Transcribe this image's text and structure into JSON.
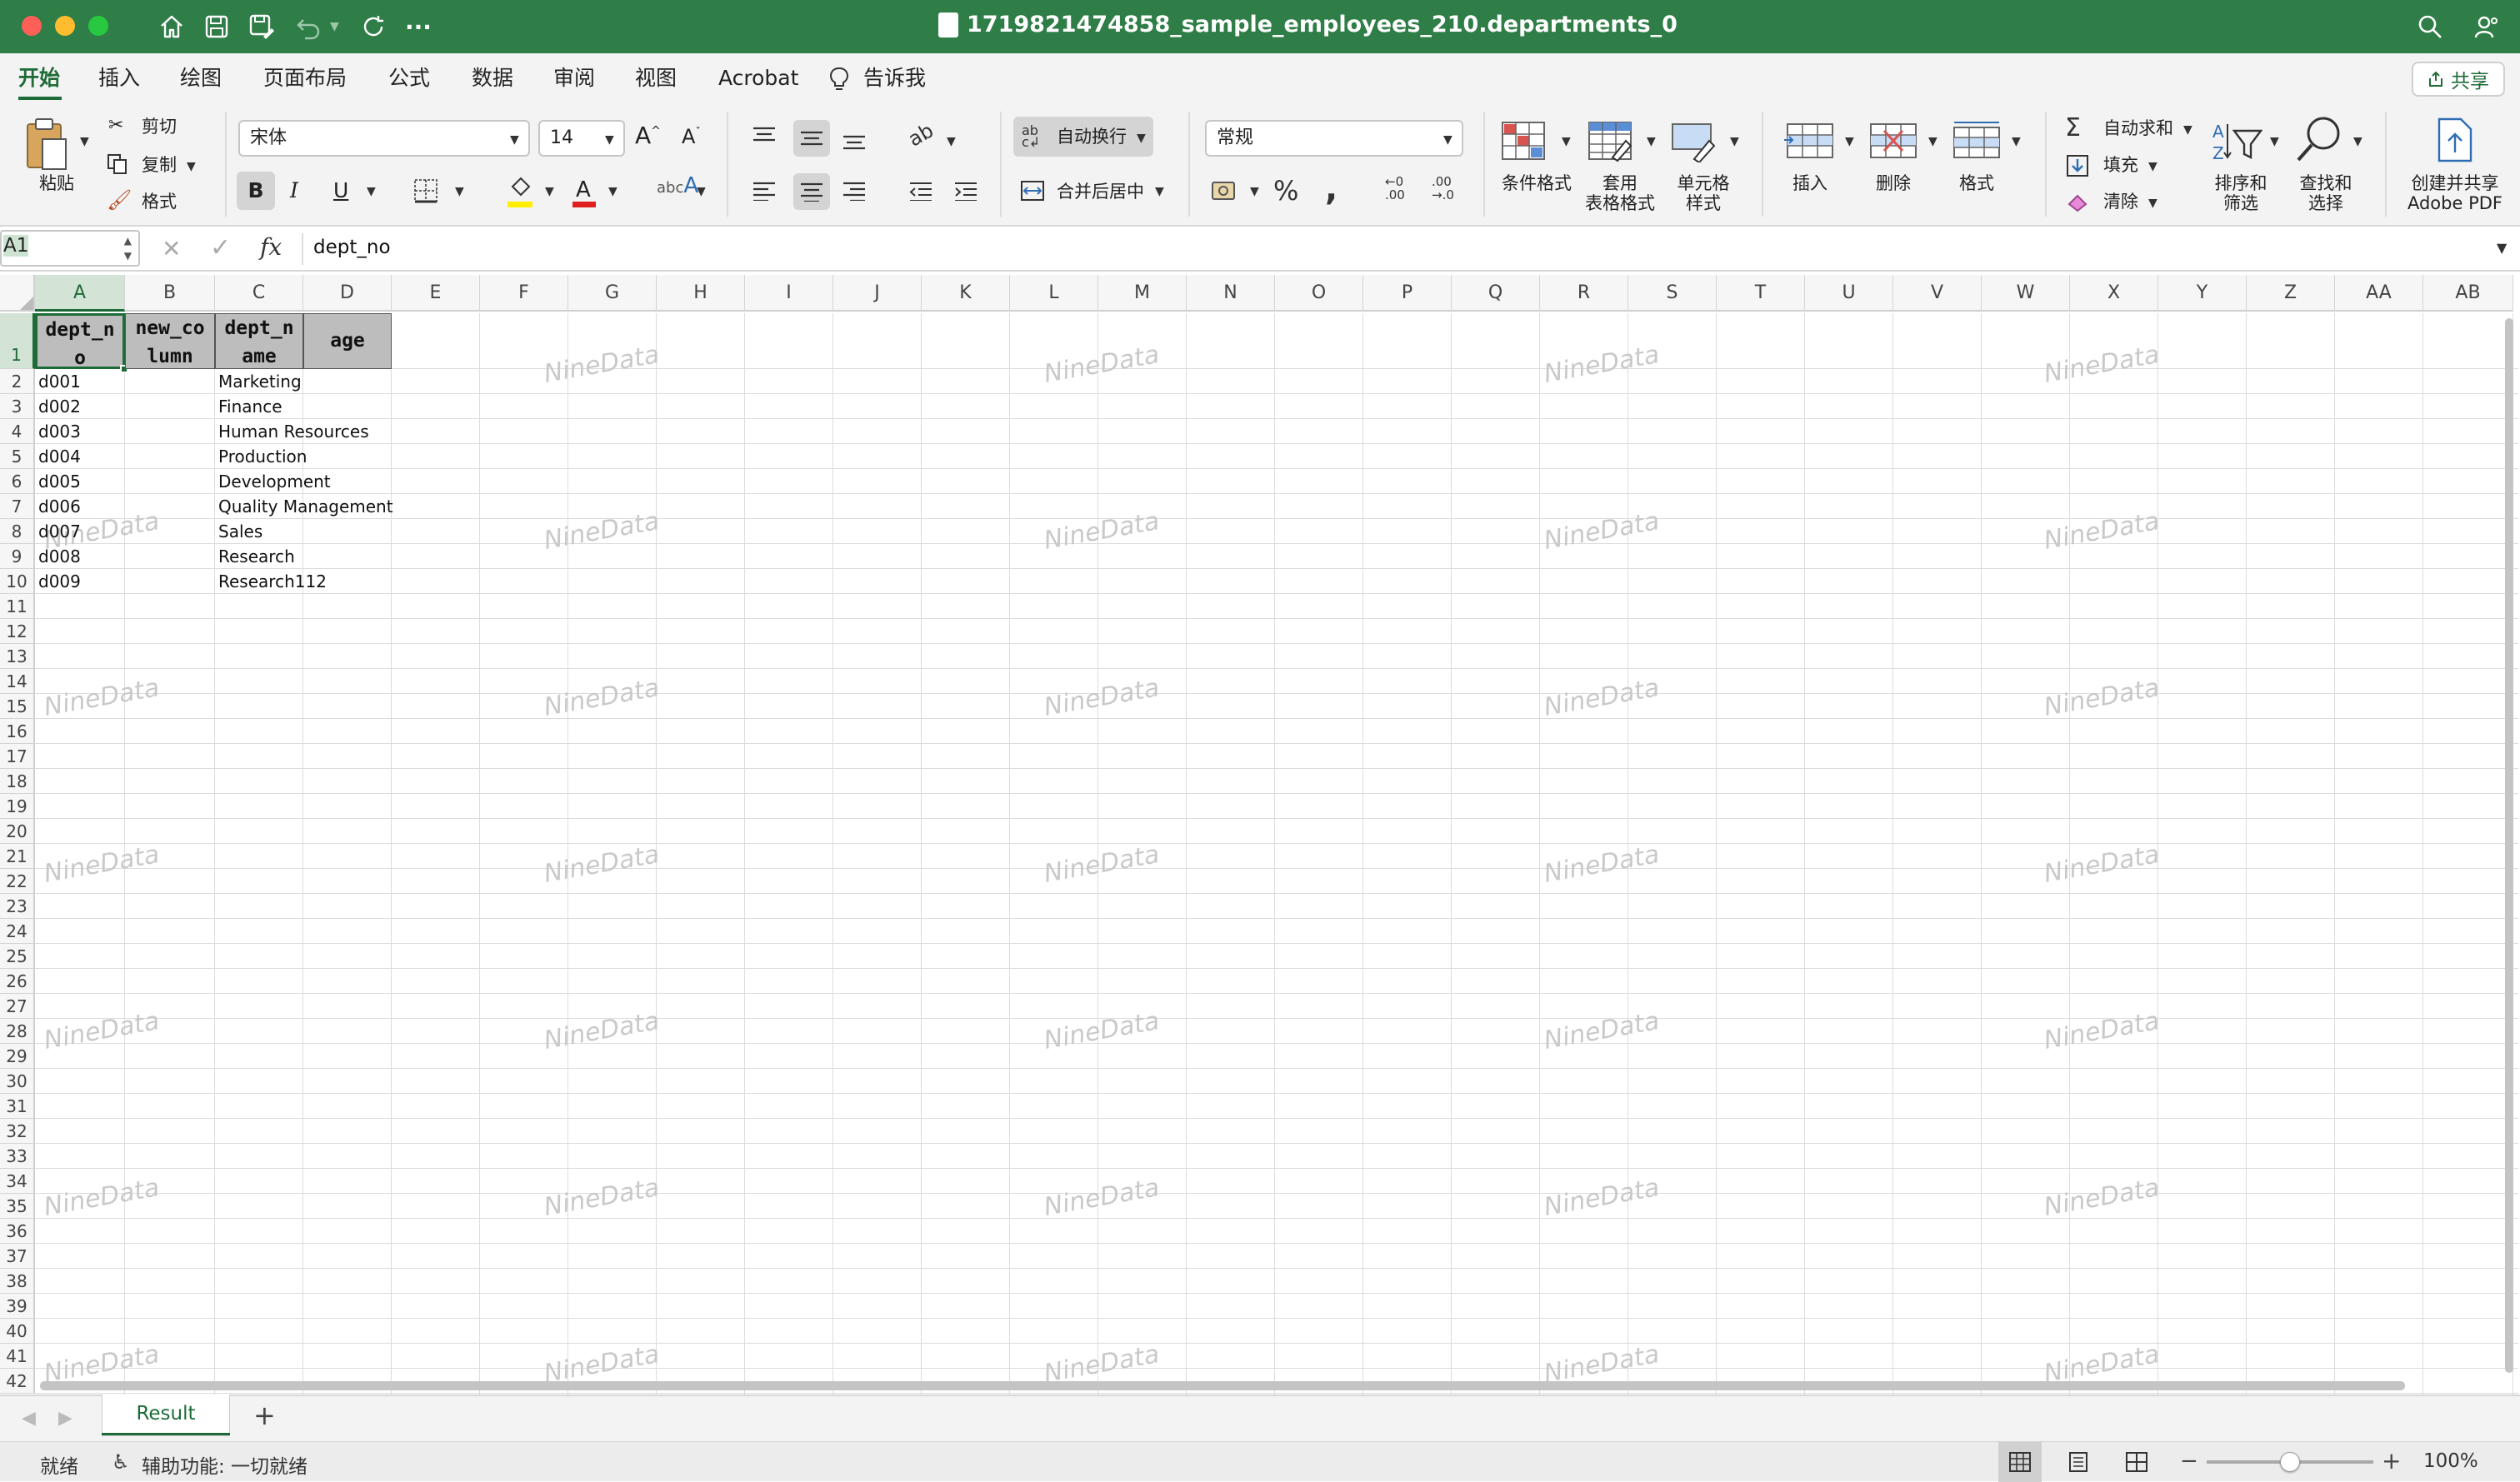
{
  "window": {
    "title": "1719821474858_sample_employees_210.departments_0",
    "accent": "#2f7d47"
  },
  "ribbon_tabs": [
    "开始",
    "插入",
    "绘图",
    "页面布局",
    "公式",
    "数据",
    "审阅",
    "视图",
    "Acrobat",
    "告诉我"
  ],
  "share_label": "共享",
  "clipboard": {
    "paste": "粘贴",
    "cut": "剪切",
    "copy": "复制",
    "format": "格式"
  },
  "font": {
    "name": "宋体",
    "size": "14",
    "bold": "B",
    "italic": "I",
    "underline": "U"
  },
  "alignment": {
    "wrap": "自动换行",
    "merge": "合并后居中"
  },
  "number": {
    "format": "常规",
    "percent": "%",
    "comma": ","
  },
  "styles": {
    "conditional": "条件格式",
    "table_line1": "套用",
    "table_line2": "表格格式",
    "cell_line1": "单元格",
    "cell_line2": "样式"
  },
  "cells_group": {
    "insert": "插入",
    "delete": "删除",
    "format": "格式"
  },
  "editing": {
    "autosum": "自动求和",
    "fill": "填充",
    "clear": "清除",
    "sort_line1": "排序和",
    "sort_line2": "筛选",
    "find_line1": "查找和",
    "find_line2": "选择"
  },
  "acrobat": {
    "line1": "创建并共享",
    "line2": "Adobe PDF"
  },
  "formula_bar": {
    "name_box": "A1",
    "fx": "fx",
    "formula": "dept_no"
  },
  "columns": [
    "A",
    "B",
    "C",
    "D",
    "E",
    "F",
    "G",
    "H",
    "I",
    "J",
    "K",
    "L",
    "M",
    "N",
    "O",
    "P",
    "Q",
    "R",
    "S",
    "T",
    "U",
    "V",
    "W",
    "X",
    "Y",
    "Z",
    "AA",
    "AB"
  ],
  "header_row": {
    "a_line1": "dept_n",
    "a_line2": "o",
    "b_line1": "new_co",
    "b_line2": "lumn",
    "c_line1": "dept_n",
    "c_line2": "ame",
    "d": "age"
  },
  "rows": [
    {
      "dept_no": "d001",
      "dept_name": "Marketing"
    },
    {
      "dept_no": "d002",
      "dept_name": "Finance"
    },
    {
      "dept_no": "d003",
      "dept_name": "Human Resources"
    },
    {
      "dept_no": "d004",
      "dept_name": "Production"
    },
    {
      "dept_no": "d005",
      "dept_name": "Development"
    },
    {
      "dept_no": "d006",
      "dept_name": "Quality Management"
    },
    {
      "dept_no": "d007",
      "dept_name": "Sales"
    },
    {
      "dept_no": "d008",
      "dept_name": "Research"
    },
    {
      "dept_no": "d009",
      "dept_name": "Research112"
    }
  ],
  "row_count": 42,
  "watermark": "NineData",
  "sheet_tab": "Result",
  "add_sheet": "+",
  "status": {
    "ready": "就绪",
    "accessibility": "辅助功能: 一切就绪",
    "zoom": "100%"
  }
}
